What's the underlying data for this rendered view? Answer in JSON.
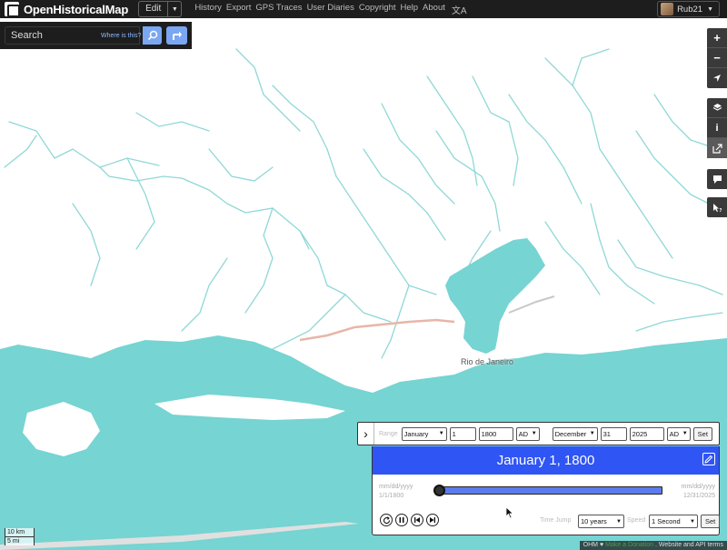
{
  "navbar": {
    "brand": "OpenHistoricalMap",
    "edit_label": "Edit",
    "links": [
      "History",
      "Export",
      "GPS Traces",
      "User Diaries",
      "Copyright",
      "Help",
      "About"
    ],
    "user": "Rub21"
  },
  "search": {
    "placeholder": "Search",
    "where_is_this": "Where is this?"
  },
  "map": {
    "city_label": "Rio de Janeiro",
    "colors": {
      "water": "#76d4d2",
      "land": "#ffffff",
      "trail": "#e7b6a8"
    }
  },
  "scale": {
    "km": "10 km",
    "mi": "5 mi"
  },
  "attribution": {
    "prefix": "OHM ♥",
    "donate": "Make a Donation",
    "terms": ". Website and API terms"
  },
  "time_slider": {
    "range_label": "Range",
    "start": {
      "month": "January",
      "day": "1",
      "year": "1800",
      "era": "AD"
    },
    "end": {
      "month": "December",
      "day": "31",
      "year": "2025",
      "era": "AD"
    },
    "set_label": "Set",
    "current_date": "January 1, 1800",
    "date_placeholder": "mm/dd/yyyy",
    "min_date": "1/1/1800",
    "max_date": "12/31/2025",
    "position_fraction": 0.0,
    "time_jump_label": "Time Jump",
    "time_jump_value": "10 years",
    "speed_label": "Speed",
    "speed_value": "1 Second",
    "accent_color": "#2f55f5"
  }
}
